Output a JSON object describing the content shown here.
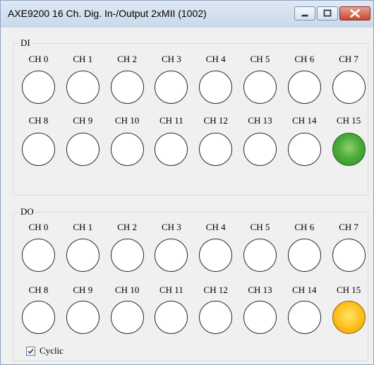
{
  "window": {
    "title": "AXE9200 16 Ch. Dig. In-/Output 2xMII (1002)",
    "buttons": {
      "minimize_icon": "minimize-icon",
      "maximize_icon": "maximize-icon",
      "close_icon": "close-icon"
    }
  },
  "di": {
    "label": "DI",
    "channels": [
      "CH 0",
      "CH 1",
      "CH 2",
      "CH 3",
      "CH 4",
      "CH 5",
      "CH 6",
      "CH 7",
      "CH 8",
      "CH 9",
      "CH 10",
      "CH 11",
      "CH 12",
      "CH 13",
      "CH 14",
      "CH 15"
    ],
    "states": [
      false,
      false,
      false,
      false,
      false,
      false,
      false,
      false,
      false,
      false,
      false,
      false,
      false,
      false,
      false,
      true
    ],
    "on_color": "#3fa535"
  },
  "do": {
    "label": "DO",
    "channels": [
      "CH 0",
      "CH 1",
      "CH 2",
      "CH 3",
      "CH 4",
      "CH 5",
      "CH 6",
      "CH 7",
      "CH 8",
      "CH 9",
      "CH 10",
      "CH 11",
      "CH 12",
      "CH 13",
      "CH 14",
      "CH 15"
    ],
    "states": [
      false,
      false,
      false,
      false,
      false,
      false,
      false,
      false,
      false,
      false,
      false,
      false,
      false,
      false,
      false,
      true
    ],
    "on_color": "#ffbf1a"
  },
  "cyclic": {
    "label": "Cyclic",
    "checked": true
  }
}
